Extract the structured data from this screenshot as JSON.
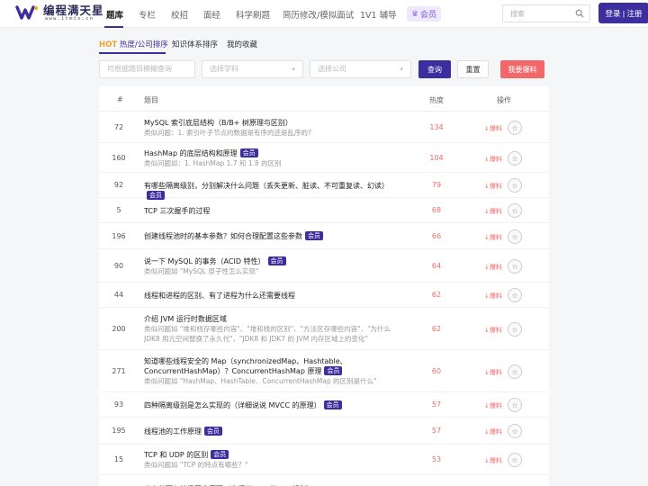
{
  "header": {
    "logo_name": "编程满天星",
    "logo_url": "www.itmtx.cn",
    "nav": [
      "题库",
      "专栏",
      "校招",
      "面经",
      "科学刷题",
      "简历修改/模拟面试",
      "1V1 辅导"
    ],
    "vip_label": "会员",
    "search_placeholder": "搜索",
    "login_label": "登录 | 注册"
  },
  "subtabs": {
    "hot_prefix": "HOT",
    "hot_label": "热度/公司排序",
    "system_label": "知识体系排序",
    "favorites_label": "我的收藏"
  },
  "filters": {
    "keyword_placeholder": "可根据题目模糊查询",
    "subject_placeholder": "选择学科",
    "company_placeholder": "选择公司",
    "query_label": "查询",
    "reset_label": "重置",
    "report_label": "我要爆料"
  },
  "table": {
    "columns": {
      "idx": "#",
      "title": "题目",
      "heat": "热度",
      "action": "操作"
    },
    "report_text": "↓爆料",
    "badge_text": "会员",
    "rows": [
      {
        "idx": "72",
        "title": "MySQL 索引底层结构（B/B+ 树原理与区别）",
        "sub": "类似问题：1. 索引叶子节点的数据是有序的还是乱序的?",
        "heat": "134",
        "vip": false
      },
      {
        "idx": "160",
        "title": "HashMap 的底层结构和原理",
        "sub": "类似问题如：1. HashMap 1.7 和 1.8 的区别",
        "heat": "104",
        "vip": true
      },
      {
        "idx": "92",
        "title": "有哪些隔离级别，分别解决什么问题（丢失更新、脏读、不可重复读、幻读）",
        "sub": "",
        "heat": "79",
        "vip": true
      },
      {
        "idx": "5",
        "title": "TCP 三次握手的过程",
        "sub": "",
        "heat": "68",
        "vip": false
      },
      {
        "idx": "196",
        "title": "创建线程池时的基本参数？如何合理配置这些参数",
        "sub": "",
        "heat": "66",
        "vip": true
      },
      {
        "idx": "90",
        "title": "说一下 MySQL 的事务（ACID 特性）",
        "sub": "类似问题如 \"MySQL 原子性怎么实现\"",
        "heat": "64",
        "vip": true
      },
      {
        "idx": "44",
        "title": "线程和进程的区别、有了进程为什么还需要线程",
        "sub": "",
        "heat": "62",
        "vip": false
      },
      {
        "idx": "200",
        "title": "介绍 JVM 运行时数据区域",
        "sub": "类似问题如 \"堆和栈存哪些内容\"、\"堆和栈的区别\"、\"方法区存哪些内容\"、\"为什么 JDK8 用元空间替换了永久代\"、\"JDK8 和 JDK7 的 JVM 内存区域上的变化\"",
        "heat": "62",
        "vip": false
      },
      {
        "idx": "271",
        "title": "知道哪些线程安全的 Map（synchronizedMap、Hashtable、ConcurrentHashMap）？ConcurrentHashMap 原理",
        "sub": "类似问题如 \"HashMap、HashTable、ConcurrentHashMap 的区别是什么\"",
        "heat": "60",
        "vip": true
      },
      {
        "idx": "93",
        "title": "四种隔离级别是怎么实现的（详细说说 MVCC 的原理）",
        "sub": "",
        "heat": "57",
        "vip": true
      },
      {
        "idx": "195",
        "title": "线程池的工作原理",
        "sub": "",
        "heat": "57",
        "vip": true
      },
      {
        "idx": "15",
        "title": "TCP 和 UDP 的区别",
        "sub": "类似问题如 \"TCP 的特点有哪些？\"",
        "heat": "53",
        "vip": true
      },
      {
        "idx": "",
        "title": "内存分配与垃圾回收原理（介绍下 JVM 的 GC 机制）",
        "sub": "",
        "heat": "",
        "vip": false
      }
    ]
  }
}
